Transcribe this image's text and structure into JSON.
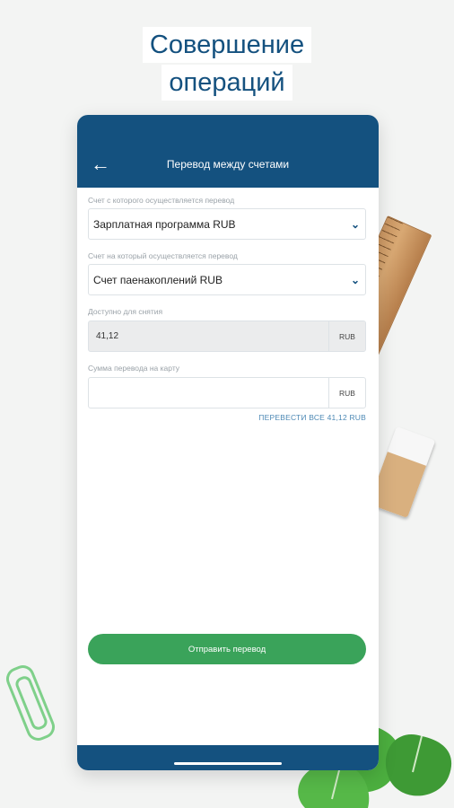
{
  "promo": {
    "line1": "Совершение",
    "line2": "операций"
  },
  "appbar": {
    "title": "Перевод между счетами",
    "back_icon": "arrow-left-icon"
  },
  "form": {
    "from_label": "Счет с которого осуществляется перевод",
    "from_value": "Зарплатная программа RUB",
    "to_label": "Счет на который осуществляется перевод",
    "to_value": "Счет паенакоплений RUB",
    "available_label": "Доступно для снятия",
    "available_value": "41,12",
    "available_currency": "RUB",
    "amount_label": "Сумма перевода на карту",
    "amount_value": "",
    "amount_currency": "RUB",
    "transfer_all_link": "ПЕРЕВЕСТИ ВСЕ 41,12 RUB"
  },
  "submit_label": "Отправить перевод",
  "colors": {
    "primary": "#14517f",
    "accent_green": "#3aa35a",
    "link": "#4d89b5"
  }
}
